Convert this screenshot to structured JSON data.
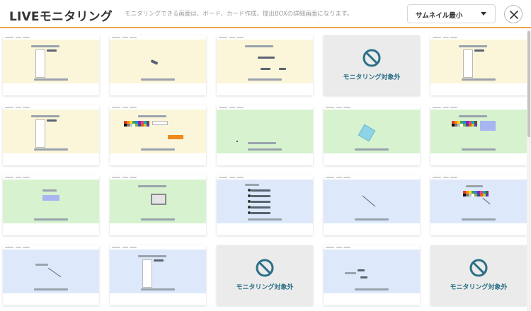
{
  "header": {
    "title": "LIVEモニタリング",
    "subtitle": "モニタリングできる画面は、ボード、カード作成、提出BOXの詳細画面になります。",
    "thumbnail_size_select": {
      "value": "サムネイル最小"
    }
  },
  "excluded_label": "モニタリング対象外",
  "colors": {
    "accent_line": "#f0a347",
    "excluded_icon": "#2a6f86",
    "yellow_board": "#fbf6da",
    "green_board": "#d6f2cf",
    "blue_board": "#dde9fb"
  },
  "grid": {
    "rows": [
      [
        {
          "state": "monitoring",
          "bg": "yellow",
          "content": "vertical-list"
        },
        {
          "state": "monitoring",
          "bg": "yellow",
          "content": "small-tag"
        },
        {
          "state": "monitoring",
          "bg": "yellow",
          "content": "cards"
        },
        {
          "state": "excluded"
        },
        {
          "state": "monitoring",
          "bg": "yellow",
          "content": "vertical-list"
        }
      ],
      [
        {
          "state": "monitoring",
          "bg": "yellow",
          "content": "vertical-list"
        },
        {
          "state": "monitoring",
          "bg": "yellow",
          "content": "palette-orange"
        },
        {
          "state": "monitoring",
          "bg": "green",
          "content": "dot"
        },
        {
          "state": "monitoring",
          "bg": "green",
          "content": "diamond"
        },
        {
          "state": "monitoring",
          "bg": "green",
          "content": "palette-blue"
        }
      ],
      [
        {
          "state": "monitoring",
          "bg": "green",
          "content": "label-box"
        },
        {
          "state": "monitoring",
          "bg": "green",
          "content": "image-box"
        },
        {
          "state": "monitoring",
          "bg": "blue",
          "content": "lines"
        },
        {
          "state": "monitoring",
          "bg": "blue",
          "content": "diagonal"
        },
        {
          "state": "monitoring",
          "bg": "blue",
          "content": "palette-plain"
        }
      ],
      [
        {
          "state": "monitoring",
          "bg": "blue",
          "content": "diagonal-label"
        },
        {
          "state": "monitoring",
          "bg": "blue",
          "content": "vertical-list"
        },
        {
          "state": "excluded"
        },
        {
          "state": "monitoring",
          "bg": "blue",
          "content": "arrows"
        },
        {
          "state": "excluded"
        }
      ]
    ]
  }
}
